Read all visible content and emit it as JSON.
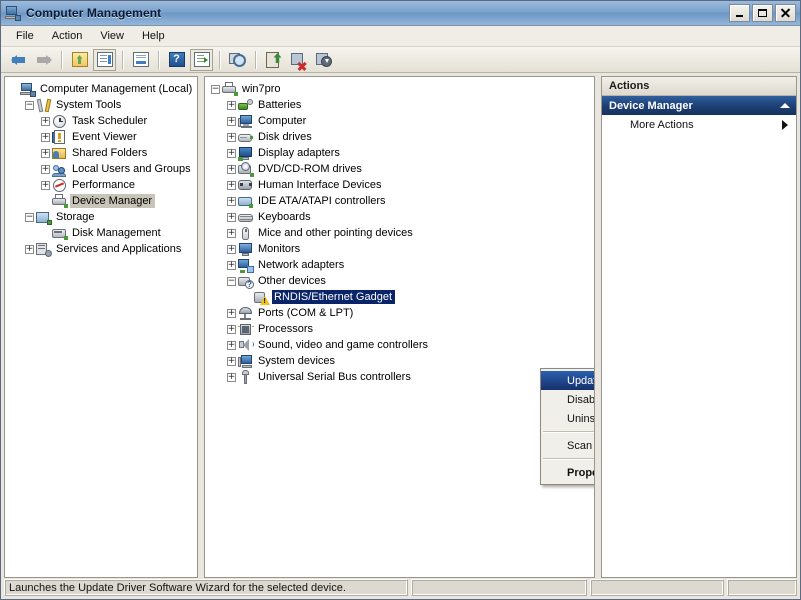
{
  "window": {
    "title": "Computer Management",
    "icon": "computer-management-icon",
    "buttons": {
      "minimize": "_",
      "maximize": "□",
      "close": "✕"
    }
  },
  "menubar": [
    {
      "label": "File"
    },
    {
      "label": "Action"
    },
    {
      "label": "View"
    },
    {
      "label": "Help"
    }
  ],
  "toolbar": [
    {
      "name": "back-arrow-icon",
      "tip": "Back"
    },
    {
      "name": "forward-arrow-icon",
      "tip": "Forward"
    },
    {
      "name": "up-one-level-icon",
      "tip": "Up One Level"
    },
    {
      "name": "show-hide-console-tree-icon",
      "tip": "Show/Hide Console Tree"
    },
    {
      "name": "properties-icon",
      "tip": "Properties"
    },
    {
      "name": "help-icon",
      "tip": "Help"
    },
    {
      "name": "show-hide-action-pane-icon",
      "tip": "Show/Hide Action Pane"
    },
    {
      "name": "scan-for-hardware-changes-icon",
      "tip": "Scan for hardware changes"
    },
    {
      "name": "update-driver-software-icon",
      "tip": "Update Driver Software"
    },
    {
      "name": "disable-device-icon",
      "tip": "Disable"
    },
    {
      "name": "uninstall-device-icon",
      "tip": "Uninstall"
    }
  ],
  "console_tree": {
    "items": [
      {
        "label": "Computer Management (Local)",
        "indent": 0,
        "expander": "",
        "icon": "computer-management-icon",
        "selected": false
      },
      {
        "label": "System Tools",
        "indent": 1,
        "expander": "−",
        "icon": "system-tools-icon",
        "selected": false
      },
      {
        "label": "Task Scheduler",
        "indent": 2,
        "expander": "+",
        "icon": "task-scheduler-icon",
        "selected": false
      },
      {
        "label": "Event Viewer",
        "indent": 2,
        "expander": "+",
        "icon": "event-viewer-icon",
        "selected": false
      },
      {
        "label": "Shared Folders",
        "indent": 2,
        "expander": "+",
        "icon": "shared-folders-icon",
        "selected": false
      },
      {
        "label": "Local Users and Groups",
        "indent": 2,
        "expander": "+",
        "icon": "local-users-groups-icon",
        "selected": false
      },
      {
        "label": "Performance",
        "indent": 2,
        "expander": "+",
        "icon": "performance-icon",
        "selected": false
      },
      {
        "label": "Device Manager",
        "indent": 2,
        "expander": "",
        "icon": "device-manager-icon",
        "selected": true
      },
      {
        "label": "Storage",
        "indent": 1,
        "expander": "−",
        "icon": "storage-icon",
        "selected": false
      },
      {
        "label": "Disk Management",
        "indent": 2,
        "expander": "",
        "icon": "disk-management-icon",
        "selected": false
      },
      {
        "label": "Services and Applications",
        "indent": 1,
        "expander": "+",
        "icon": "services-applications-icon",
        "selected": false
      }
    ]
  },
  "device_tree": {
    "items": [
      {
        "label": "win7pro",
        "indent": 0,
        "expander": "−",
        "icon": "computer-node-icon",
        "selected": false
      },
      {
        "label": "Batteries",
        "indent": 1,
        "expander": "+",
        "icon": "batteries-icon",
        "selected": false
      },
      {
        "label": "Computer",
        "indent": 1,
        "expander": "+",
        "icon": "computer-icon",
        "selected": false
      },
      {
        "label": "Disk drives",
        "indent": 1,
        "expander": "+",
        "icon": "disk-drives-icon",
        "selected": false
      },
      {
        "label": "Display adapters",
        "indent": 1,
        "expander": "+",
        "icon": "display-adapters-icon",
        "selected": false
      },
      {
        "label": "DVD/CD-ROM drives",
        "indent": 1,
        "expander": "+",
        "icon": "dvd-cdrom-icon",
        "selected": false
      },
      {
        "label": "Human Interface Devices",
        "indent": 1,
        "expander": "+",
        "icon": "human-interface-devices-icon",
        "selected": false
      },
      {
        "label": "IDE ATA/ATAPI controllers",
        "indent": 1,
        "expander": "+",
        "icon": "ide-controllers-icon",
        "selected": false
      },
      {
        "label": "Keyboards",
        "indent": 1,
        "expander": "+",
        "icon": "keyboards-icon",
        "selected": false
      },
      {
        "label": "Mice and other pointing devices",
        "indent": 1,
        "expander": "+",
        "icon": "mice-icon",
        "selected": false
      },
      {
        "label": "Monitors",
        "indent": 1,
        "expander": "+",
        "icon": "monitors-icon",
        "selected": false
      },
      {
        "label": "Network adapters",
        "indent": 1,
        "expander": "+",
        "icon": "network-adapters-icon",
        "selected": false
      },
      {
        "label": "Other devices",
        "indent": 1,
        "expander": "−",
        "icon": "other-devices-icon",
        "selected": false
      },
      {
        "label": "RNDIS/Ethernet Gadget",
        "indent": 2,
        "expander": "",
        "icon": "unknown-device-warning-icon",
        "selected": true
      },
      {
        "label": "Ports (COM & LPT)",
        "indent": 1,
        "expander": "+",
        "icon": "ports-icon",
        "selected": false
      },
      {
        "label": "Processors",
        "indent": 1,
        "expander": "+",
        "icon": "processors-icon",
        "selected": false
      },
      {
        "label": "Sound, video and game controllers",
        "indent": 1,
        "expander": "+",
        "icon": "sound-video-icon",
        "selected": false
      },
      {
        "label": "System devices",
        "indent": 1,
        "expander": "+",
        "icon": "system-devices-icon",
        "selected": false
      },
      {
        "label": "Universal Serial Bus controllers",
        "indent": 1,
        "expander": "+",
        "icon": "usb-controllers-icon",
        "selected": false
      }
    ]
  },
  "context_menu": {
    "items": [
      {
        "label": "Update Driver Software...",
        "highlighted": true,
        "bold": false,
        "separator_after": false
      },
      {
        "label": "Disable",
        "highlighted": false,
        "bold": false,
        "separator_after": false
      },
      {
        "label": "Uninstall",
        "highlighted": false,
        "bold": false,
        "separator_after": true
      },
      {
        "label": "Scan for hardware changes",
        "highlighted": false,
        "bold": false,
        "separator_after": true
      },
      {
        "label": "Properties",
        "highlighted": false,
        "bold": true,
        "separator_after": false
      }
    ]
  },
  "actions_pane": {
    "header": "Actions",
    "section_title": "Device Manager",
    "items": [
      {
        "label": "More Actions",
        "has_submenu": true
      }
    ]
  },
  "statusbar": {
    "panes": [
      "Launches the Update Driver Software Wizard for the selected device.",
      "",
      "",
      ""
    ]
  },
  "colors": {
    "title_gradient_start": "#9dbbdd",
    "title_gradient_end": "#95b6d9",
    "selection_blue": "#0a246a",
    "selection_inactive_gray": "#c9c4b8",
    "actions_section_blue": "#1d3f73",
    "menu_highlight_blue": "#2a5fae",
    "window_background": "#e9e6df"
  }
}
